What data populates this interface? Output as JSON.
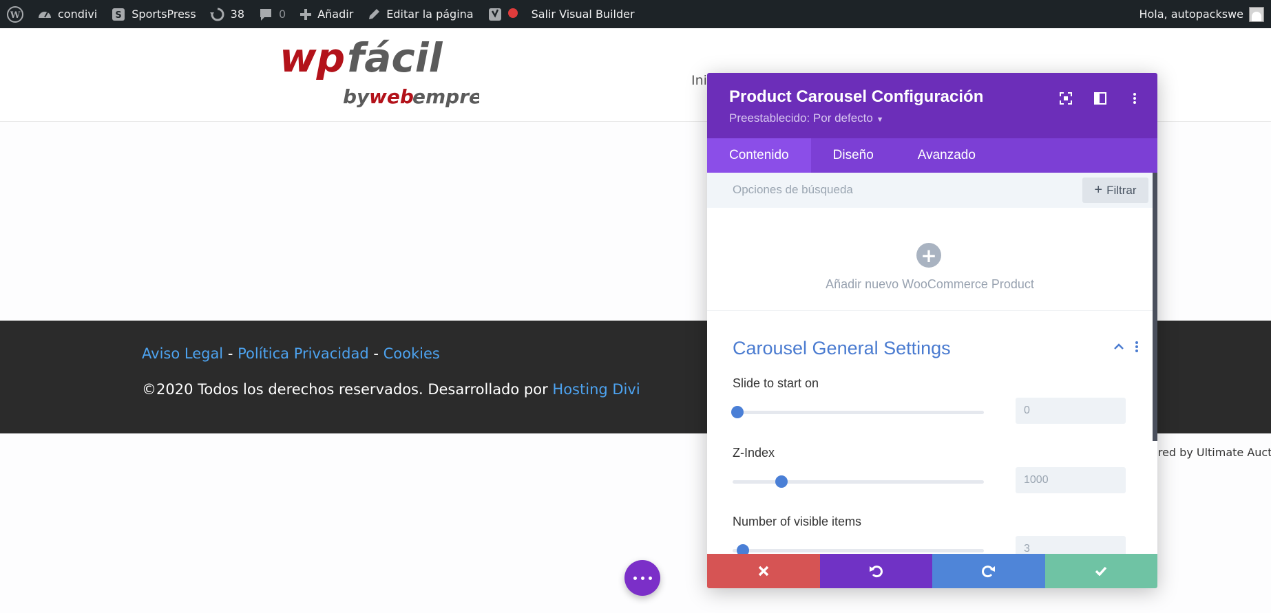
{
  "adminbar": {
    "site_name": "condivi",
    "sportspress": "SportsPress",
    "updates_count": "38",
    "comments_count": "0",
    "add_new": "Añadir",
    "edit_page": "Editar la página",
    "exit_builder": "Salir Visual Builder",
    "greeting": "Hola, autopackswe"
  },
  "header": {
    "logo_text_main": "wpfácil",
    "logo_text_by": "by",
    "logo_text_web": "web",
    "logo_text_empresa": "empresa",
    "nav_fragment": "Ini"
  },
  "footer": {
    "link_legal": "Aviso Legal",
    "separator": "-",
    "link_privacy": "Política Privacidad",
    "link_cookies": "Cookies",
    "copyright": "©2020 Todos los derechos reservados. Desarrollado por",
    "link_hosting": "Hosting Divi",
    "powered_by": "ered by Ultimate Auction"
  },
  "modal": {
    "title": "Product Carousel Configuración",
    "preset": "Preestablecido: Por defecto",
    "tabs": [
      {
        "label": "Contenido",
        "active": true
      },
      {
        "label": "Diseño",
        "active": false
      },
      {
        "label": "Avanzado",
        "active": false
      }
    ],
    "search_placeholder": "Opciones de búsqueda",
    "filter_label": "Filtrar",
    "add_item_label": "Añadir nuevo WooCommerce Product",
    "section_title": "Carousel General Settings",
    "fields": [
      {
        "label": "Slide to start on",
        "value": "0",
        "slider_fraction": 0.0
      },
      {
        "label": "Z-Index",
        "value": "1000",
        "slider_fraction": 0.17
      },
      {
        "label": "Number of visible items",
        "value": "3",
        "slider_fraction": 0.04
      }
    ],
    "footer_buttons": [
      "cancel",
      "undo",
      "redo",
      "save"
    ]
  },
  "colors": {
    "adminbar_bg": "#1d2327",
    "modal_header": "#6c2eb9",
    "modal_tabs": "#7c3fd5",
    "cancel": "#d65454",
    "undo": "#7032c5",
    "redo": "#4f85d8",
    "save": "#6fc3a4",
    "link": "#4da3f0"
  }
}
